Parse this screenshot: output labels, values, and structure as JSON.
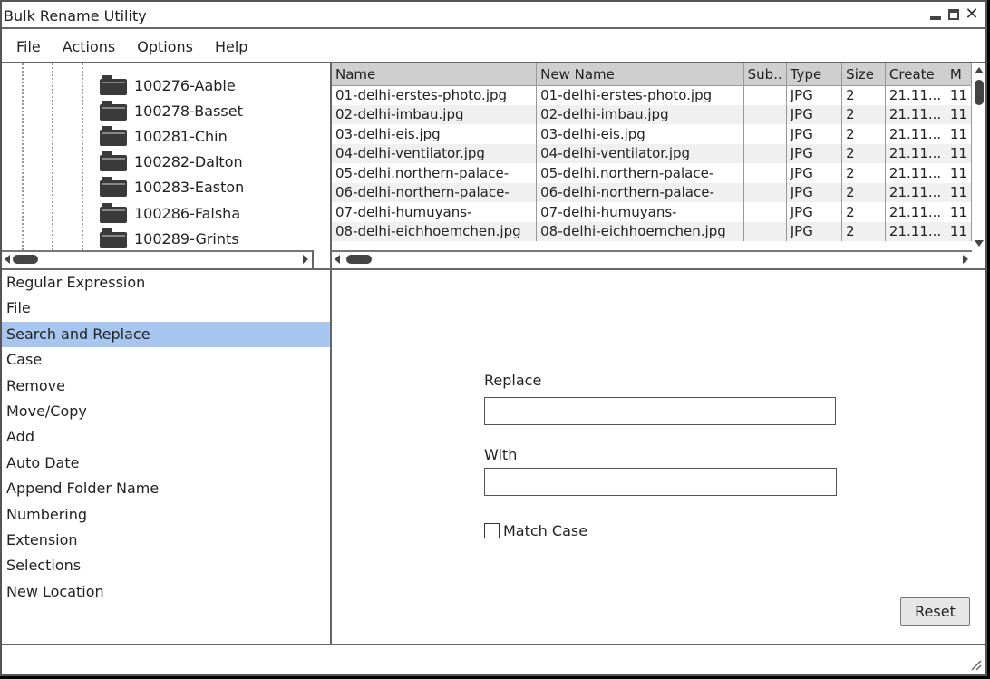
{
  "window": {
    "title": "Bulk Rename Utility"
  },
  "menu": [
    "File",
    "Actions",
    "Options",
    "Help"
  ],
  "folders": [
    "100276-Aable",
    "100278-Basset",
    "100281-Chin",
    "100282-Dalton",
    "100283-Easton",
    "100286-Falsha",
    "100289-Grints"
  ],
  "files": {
    "columns": [
      "Name",
      "New Name",
      "Sub..",
      "Type",
      "Size",
      "Create",
      "M"
    ],
    "rows": [
      [
        "01-delhi-erstes-photo.jpg",
        "01-delhi-erstes-photo.jpg",
        "",
        "JPG",
        "2",
        "21.11...",
        "11"
      ],
      [
        "02-delhi-imbau.jpg",
        "02-delhi-imbau.jpg",
        "",
        "JPG",
        "2",
        "21.11...",
        "11"
      ],
      [
        "03-delhi-eis.jpg",
        "03-delhi-eis.jpg",
        "",
        "JPG",
        "2",
        "21.11...",
        "11"
      ],
      [
        "04-delhi-ventilator.jpg",
        "04-delhi-ventilator.jpg",
        "",
        "JPG",
        "2",
        "21.11...",
        "11"
      ],
      [
        "05-delhi.northern-palace-",
        "05-delhi.northern-palace-",
        "",
        "JPG",
        "2",
        "21.11...",
        "11"
      ],
      [
        "06-delhi-northern-palace-",
        "06-delhi-northern-palace-",
        "",
        "JPG",
        "2",
        "21.11...",
        "11"
      ],
      [
        "07-delhi-humuyans-",
        "07-delhi-humuyans-",
        "",
        "JPG",
        "2",
        "21.11...",
        "11"
      ],
      [
        "08-delhi-eichhoemchen.jpg",
        "08-delhi-eichhoemchen.jpg",
        "",
        "JPG",
        "2",
        "21.11...",
        "11"
      ]
    ]
  },
  "functions": {
    "items": [
      "Regular Expression",
      "File",
      "Search and Replace",
      "Case",
      "Remove",
      "Move/Copy",
      "Add",
      "Auto Date",
      "Append Folder Name",
      "Numbering",
      "Extension",
      "Selections",
      "New Location"
    ],
    "selected": "Search and Replace"
  },
  "settings": {
    "replace_label": "Replace",
    "replace_value": "",
    "with_label": "With",
    "with_value": "",
    "match_case_label": "Match Case",
    "match_case_checked": false,
    "reset_label": "Reset"
  },
  "colors": {
    "selected_bg": "#a7c6ef",
    "header_bg": "#cfcfcf"
  }
}
